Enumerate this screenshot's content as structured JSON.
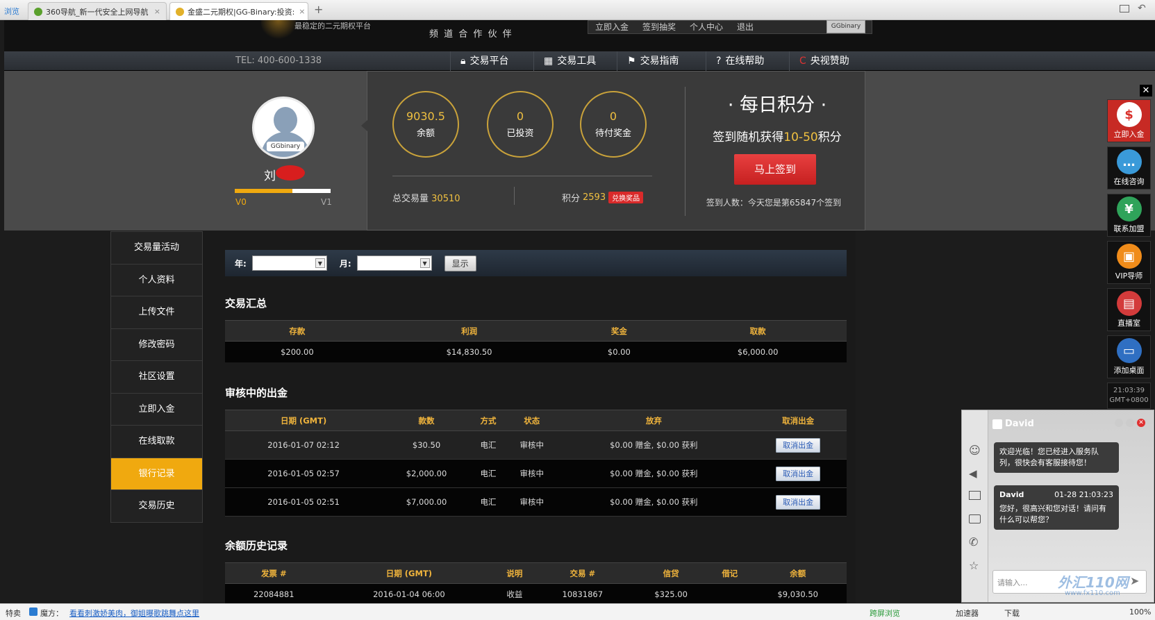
{
  "browser": {
    "tabs": [
      {
        "label": "浏览"
      },
      {
        "label": "360导航_新一代安全上网导航",
        "close": "×"
      },
      {
        "label": "金盛二元期权|GG-Binary:投资:",
        "close": "×"
      }
    ],
    "new_tab": "+"
  },
  "header": {
    "slogan": "最稳定的二元期权平台",
    "partner": "频 道 合 作 伙 伴",
    "top_links": [
      "立即入金",
      "签到抽奖",
      "个人中心",
      "退出"
    ],
    "logo_text": "GGbinary",
    "tel": "TEL: 400-600-1338",
    "nav": [
      {
        "label": "交易平台",
        "icon": "lock-icon"
      },
      {
        "label": "交易工具",
        "icon": "calculator-icon"
      },
      {
        "label": "交易指南",
        "icon": "flag-icon"
      },
      {
        "label": "在线帮助",
        "icon": "help-icon"
      },
      {
        "label": "央视赞助",
        "icon": "cctv-icon"
      }
    ]
  },
  "profile": {
    "avatar_brand": "GGbinary",
    "name": "刘",
    "level_from": "V0",
    "level_to": "V1",
    "level_progress": 0.6
  },
  "account": {
    "stats": [
      {
        "value": "9030.5",
        "label": "余额"
      },
      {
        "value": "0",
        "label": "已投资"
      },
      {
        "value": "0",
        "label": "待付奖金"
      }
    ],
    "total_volume_label": "总交易量",
    "total_volume": "30510",
    "points_label": "积分",
    "points": "2593",
    "redeem_label": "兑换奖品"
  },
  "daily": {
    "title": "· 每日积分 ·",
    "desc_prefix": "签到随机获得",
    "desc_range": "10-50",
    "desc_suffix": "积分",
    "button": "马上签到",
    "count_text": "签到人数：今天您是第65847个签到"
  },
  "sidebar": {
    "items": [
      {
        "label": "交易量活动"
      },
      {
        "label": "个人资料"
      },
      {
        "label": "上传文件"
      },
      {
        "label": "修改密码"
      },
      {
        "label": "社区设置"
      },
      {
        "label": "立即入金"
      },
      {
        "label": "在线取款"
      },
      {
        "label": "银行记录",
        "active": true
      },
      {
        "label": "交易历史"
      }
    ]
  },
  "filter": {
    "year_label": "年:",
    "month_label": "月:",
    "show_button": "显示"
  },
  "summary": {
    "title": "交易汇总",
    "headers": [
      "存款",
      "利润",
      "奖金",
      "取款"
    ],
    "row": [
      "$200.00",
      "$14,830.50",
      "$0.00",
      "$6,000.00"
    ]
  },
  "pending": {
    "title": "审核中的出金",
    "headers": [
      "日期 (GMT)",
      "款数",
      "方式",
      "状态",
      "放弃",
      "取消出金"
    ],
    "rows": [
      {
        "date": "2016-01-07 02:12",
        "amount": "$30.50",
        "method": "电汇",
        "status": "审核中",
        "forfeit": "$0.00 赠金, $0.00 获利",
        "action": "取消出金"
      },
      {
        "date": "2016-01-05 02:57",
        "amount": "$2,000.00",
        "method": "电汇",
        "status": "审核中",
        "forfeit": "$0.00 赠金, $0.00 获利",
        "action": "取消出金"
      },
      {
        "date": "2016-01-05 02:51",
        "amount": "$7,000.00",
        "method": "电汇",
        "status": "审核中",
        "forfeit": "$0.00 赠金, $0.00 获利",
        "action": "取消出金"
      }
    ]
  },
  "history": {
    "title": "余额历史记录",
    "headers": [
      "发票 #",
      "日期 (GMT)",
      "说明",
      "交易 #",
      "信贷",
      "借记",
      "余额"
    ],
    "row": [
      "22084881",
      "2016-01-04 06:00",
      "收益",
      "10831867",
      "$325.00",
      "",
      "$9,030.50"
    ]
  },
  "float_bar": {
    "close": "✕",
    "items": [
      {
        "label": "立即入金",
        "color": "#d9302a",
        "glyph": "$"
      },
      {
        "label": "在线咨询",
        "color": "#3a9ad9",
        "glyph": "…"
      },
      {
        "label": "联系加盟",
        "color": "#2fa35a",
        "glyph": "¥"
      },
      {
        "label": "VIP导师",
        "color": "#f08c1a",
        "glyph": "▣"
      },
      {
        "label": "直播室",
        "color": "#d33b3b",
        "glyph": "▤"
      },
      {
        "label": "添加桌面",
        "color": "#2f6fc2",
        "glyph": "▭"
      }
    ],
    "clock": "21:03:39",
    "timezone": "GMT+0800"
  },
  "chat": {
    "agent": "David",
    "welcome": "欢迎光临！您已经进入服务队列，很快会有客服接待您！",
    "msg_sender": "David",
    "msg_time": "01-28 21:03:23",
    "msg_text": "您好，很高兴和您对话！请问有什么可以帮您？",
    "input_placeholder": "请输入...",
    "watermark": "外汇110网",
    "watermark_url": "www.fx110.com"
  },
  "statusbar": {
    "left1": "特卖",
    "left2": "魔方：",
    "link": "看看刺激娇美肉，御姐曝歌跳舞点这里",
    "right": [
      "跨屏浏览",
      "加速器",
      "下载",
      "100%"
    ]
  }
}
